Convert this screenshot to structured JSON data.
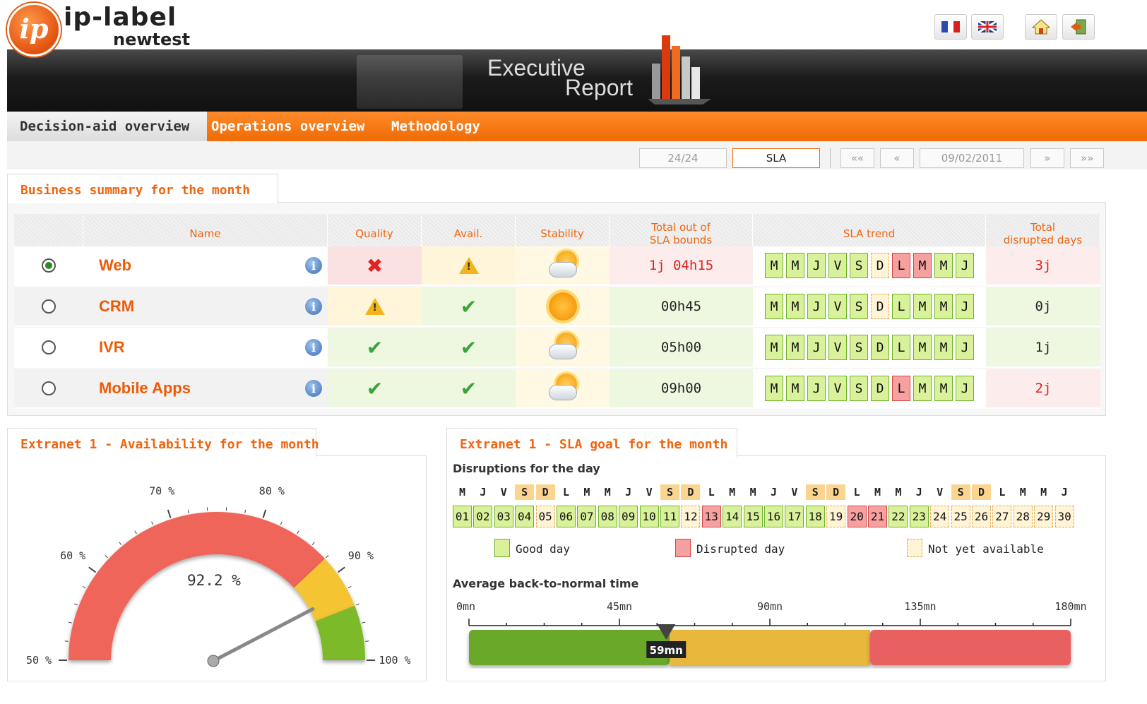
{
  "header": {
    "brand": "ip-label",
    "brand_sub": "newtest",
    "logo_letters": "ip",
    "title_line1": "Executive",
    "title_line2": "Report",
    "buttons": [
      "fr-flag-icon",
      "uk-flag-icon",
      "home-icon",
      "exit-icon"
    ]
  },
  "nav": {
    "tabs": [
      {
        "label": "Decision-aid overview"
      },
      {
        "label": "Operations overview"
      },
      {
        "label": "Methodology"
      }
    ]
  },
  "toolbar": {
    "mode1": "24/24",
    "mode2": "SLA",
    "first": "«",
    "prev": "«",
    "date": "09/02/2011",
    "next": "»",
    "last": "»"
  },
  "summary": {
    "title": "Business summary for the month",
    "headers": {
      "name": "Name",
      "quality": "Quality",
      "avail": "Avail.",
      "stability": "Stability",
      "total_out_1": "Total out of",
      "total_out_2": "SLA bounds",
      "trend": "SLA trend",
      "disrupted_1": "Total",
      "disrupted_2": "disrupted days"
    },
    "trend_days": [
      "M",
      "M",
      "J",
      "V",
      "S",
      "D",
      "L",
      "M",
      "M",
      "J"
    ],
    "rows": [
      {
        "name": "Web",
        "selected": true,
        "quality": "cross",
        "avail": "warning",
        "stability": "sun-cloud",
        "total_out": "1j 04h15",
        "disrupted": "3j",
        "trend": [
          "good",
          "good",
          "good",
          "good",
          "good",
          "na",
          "bad",
          "bad",
          "good",
          "good"
        ]
      },
      {
        "name": "CRM",
        "selected": false,
        "quality": "warning",
        "avail": "check",
        "stability": "sun",
        "total_out": "00h45",
        "disrupted": "0j",
        "trend": [
          "good",
          "good",
          "good",
          "good",
          "good",
          "na",
          "good",
          "good",
          "good",
          "good"
        ]
      },
      {
        "name": "IVR",
        "selected": false,
        "quality": "check",
        "avail": "check",
        "stability": "sun-cloud",
        "total_out": "05h00",
        "disrupted": "1j",
        "trend": [
          "good",
          "good",
          "good",
          "good",
          "good",
          "good",
          "good",
          "good",
          "good",
          "good"
        ]
      },
      {
        "name": "Mobile Apps",
        "selected": false,
        "quality": "check",
        "avail": "check",
        "stability": "sun-cloud",
        "total_out": "09h00",
        "disrupted": "2j",
        "trend": [
          "good",
          "good",
          "good",
          "good",
          "good",
          "good",
          "bad",
          "good",
          "good",
          "good"
        ]
      }
    ]
  },
  "availability": {
    "title": "Extranet 1 - Availability for the month",
    "value": "92.2 %",
    "value_num": 92.2,
    "min": 50,
    "max": 100,
    "labels": [
      "50 %",
      "60 %",
      "70 %",
      "80 %",
      "90 %",
      "100 %"
    ],
    "zones": [
      {
        "from": 50,
        "to": 88,
        "color": "#f0655a"
      },
      {
        "from": 88,
        "to": 94,
        "color": "#f5c431"
      },
      {
        "from": 94,
        "to": 100,
        "color": "#7cba2a"
      }
    ]
  },
  "sla": {
    "title": "Extranet 1 - SLA goal for the month",
    "disruptions_title": "Disruptions for the day",
    "weekdays": [
      "M",
      "J",
      "V",
      "S",
      "D",
      "L",
      "M",
      "M",
      "J",
      "V",
      "S",
      "D",
      "L",
      "M",
      "M",
      "J",
      "V",
      "S",
      "D",
      "L",
      "M",
      "M",
      "J",
      "V",
      "S",
      "D",
      "L",
      "M",
      "M",
      "J"
    ],
    "weekend_idx": [
      3,
      4,
      10,
      11,
      17,
      18,
      24,
      25
    ],
    "days": [
      "01",
      "02",
      "03",
      "04",
      "05",
      "06",
      "07",
      "08",
      "09",
      "10",
      "11",
      "12",
      "13",
      "14",
      "15",
      "16",
      "17",
      "18",
      "19",
      "20",
      "21",
      "22",
      "23",
      "24",
      "25",
      "26",
      "27",
      "28",
      "29",
      "30"
    ],
    "status": [
      "good",
      "good",
      "good",
      "good",
      "na",
      "good",
      "good",
      "good",
      "good",
      "good",
      "good",
      "na",
      "bad",
      "good",
      "good",
      "good",
      "good",
      "good",
      "na",
      "bad",
      "bad",
      "good",
      "good",
      "na",
      "na",
      "na",
      "na",
      "na",
      "na",
      "na"
    ],
    "legend": {
      "good": "Good day",
      "bad": "Disrupted day",
      "na": "Not yet available"
    },
    "avg_title": "Average back-to-normal time",
    "scale_labels": [
      "0mn",
      "45mn",
      "90mn",
      "135mn",
      "180mn"
    ],
    "scale_max": 180,
    "avg_value": 59,
    "avg_label": "59mn",
    "zones": [
      {
        "from": 0,
        "to": 60,
        "color": "#6aa82a"
      },
      {
        "from": 60,
        "to": 120,
        "color": "#e8b73a"
      },
      {
        "from": 120,
        "to": 180,
        "color": "#e86060"
      }
    ]
  }
}
